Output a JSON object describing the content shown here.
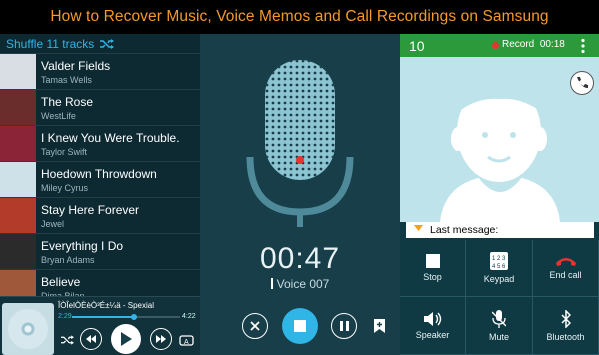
{
  "banner": {
    "title": "How to Recover Music, Voice Memos and Call Recordings on Samsung"
  },
  "music": {
    "shuffle_label": "Shuffle 11 tracks",
    "tracks": [
      {
        "title": "Valder Fields",
        "artist": "Tamas Wells",
        "color": "#d9dde4"
      },
      {
        "title": "The Rose",
        "artist": "WestLife",
        "color": "#6b2c2c"
      },
      {
        "title": "I Knew You Were Trouble.",
        "artist": "Taylor Swift",
        "color": "#8a2436"
      },
      {
        "title": "Hoedown Throwdown",
        "artist": "Miley Cyrus",
        "color": "#cfe1e8"
      },
      {
        "title": "Stay Here Forever",
        "artist": "Jewel",
        "color": "#b23b2a"
      },
      {
        "title": "Everything I Do",
        "artist": "Bryan Adams",
        "color": "#2b2b2b"
      },
      {
        "title": "Believe",
        "artist": "Dima Bilan",
        "color": "#a0583a"
      }
    ],
    "now_playing": {
      "title": "ÎÒÎelÒÈèÒ³É±¼ä - Spexial",
      "elapsed": "2:29",
      "duration": "4:22",
      "progress": 0.57
    }
  },
  "recorder": {
    "time": "00:47",
    "name": "Voice 007"
  },
  "call": {
    "number": "10",
    "record_label": "Record",
    "record_time": "00:18",
    "last_message": "Last message:",
    "buttons": [
      {
        "label": "Stop",
        "icon": "stop-icon"
      },
      {
        "label": "Keypad",
        "icon": "keypad-icon"
      },
      {
        "label": "End call",
        "icon": "end-call-icon"
      },
      {
        "label": "Speaker",
        "icon": "speaker-icon"
      },
      {
        "label": "Mute",
        "icon": "mute-icon"
      },
      {
        "label": "Bluetooth",
        "icon": "bluetooth-icon"
      }
    ]
  },
  "colors": {
    "accent": "#2fb6e6",
    "banner_text": "#f39a2b",
    "record_red": "#e8342f",
    "call_green": "#2c9a3b"
  }
}
